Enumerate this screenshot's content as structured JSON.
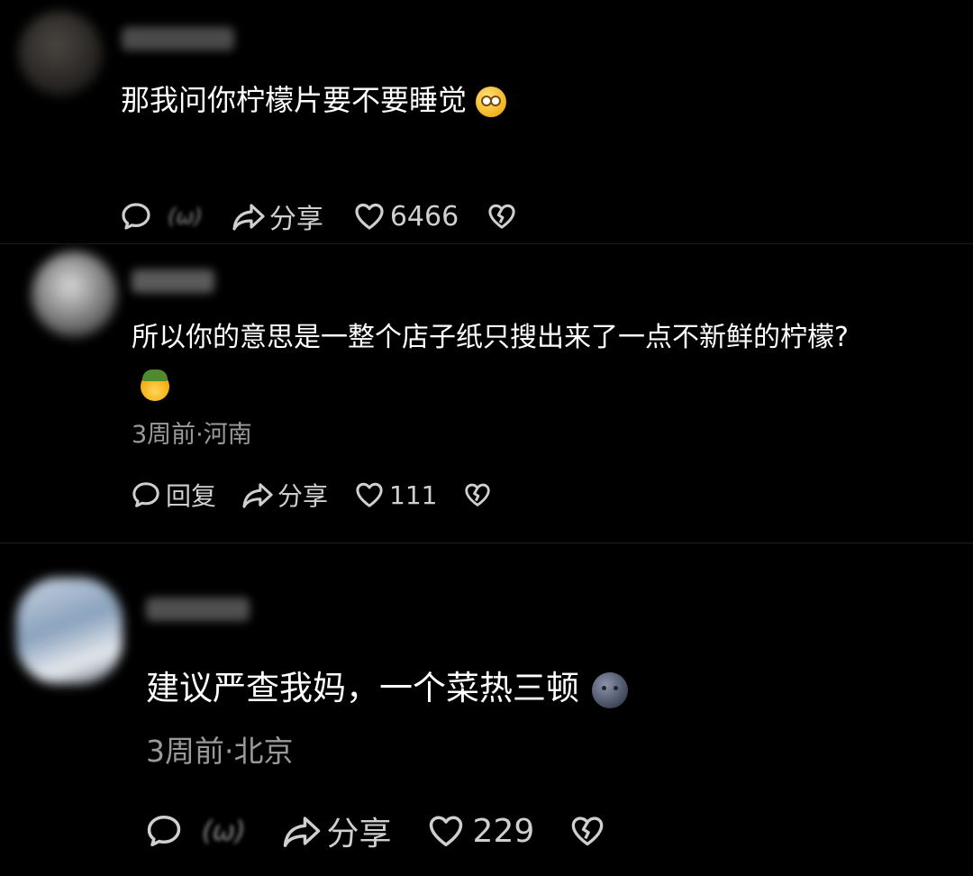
{
  "comments": [
    {
      "text": "那我问你柠檬片要不要睡觉",
      "emoji": "smiling-face-icon",
      "actions": {
        "reply_blurred": "(ω)",
        "share": "分享",
        "likes": "6466"
      }
    },
    {
      "text": "所以你的意思是一整个店子纸只搜出来了一点不新鲜的柠檬?",
      "emoji": "army-emoji-icon",
      "meta": "3周前·河南",
      "actions": {
        "reply": "回复",
        "share": "分享",
        "likes": "111"
      }
    },
    {
      "text": "建议严查我妈，一个菜热三顿",
      "emoji": "moon-face-icon",
      "meta": "3周前·北京",
      "actions": {
        "reply_blurred": "(ω)",
        "share": "分享",
        "likes": "229"
      }
    }
  ],
  "colors": {
    "background": "#000000",
    "text": "#ffffff",
    "meta": "#9a9a9a",
    "icon": "#cfcfcf"
  }
}
